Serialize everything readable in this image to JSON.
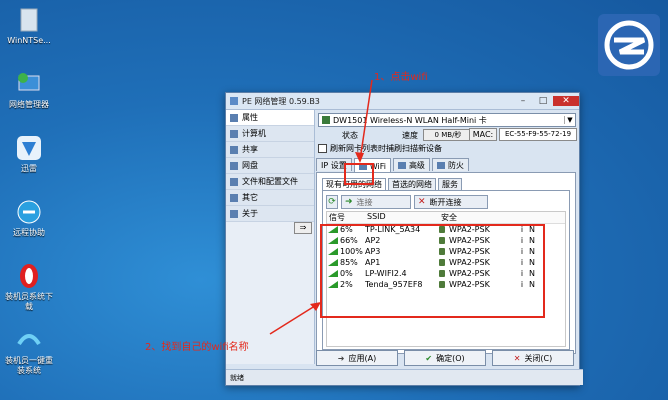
{
  "desktop": {
    "icons": [
      {
        "name": "winntsetup-icon",
        "label": "WinNTSe..."
      },
      {
        "name": "network-manager-icon",
        "label": "网络管理器"
      },
      {
        "name": "thunder-icon",
        "label": "迅雷"
      },
      {
        "name": "remote-assist-icon",
        "label": "远程协助"
      },
      {
        "name": "installer-download-icon",
        "label": "装机员系统下载"
      },
      {
        "name": "installer-onekey-icon",
        "label": "装机员一键重装系统"
      }
    ]
  },
  "window": {
    "title": "PE 网络管理 0.59.B3",
    "sidebar": [
      "属性",
      "计算机",
      "共享",
      "网盘",
      "文件和配置文件",
      "其它",
      "关于"
    ],
    "sidebar_arrow": "⇒",
    "adapter": "DW1501 Wireless-N WLAN Half-Mini 卡",
    "status_label": "状态",
    "status_value": "",
    "speed_label": "速度",
    "speed_value": "0 MB/秒",
    "mac_label": "MAC:",
    "mac_value": "EC-55-F9-55-72-19",
    "refresh_checkbox": "刷新网卡列表时捕刷扫描新设备",
    "tabs": [
      "IP 设置",
      "WiFi",
      "高级",
      "防火"
    ],
    "subtabs": [
      "现有可用的网络",
      "首选的网络",
      "服务"
    ],
    "connect_label": "连接",
    "disconnect_label": "断开连接",
    "table": {
      "headers": [
        "信号",
        "SSID",
        "安全",
        "",
        ""
      ],
      "rows": [
        {
          "signal": "6%",
          "ssid": "TP-LINK_5A34",
          "security": "WPA2-PSK",
          "i": "i",
          "n": "N"
        },
        {
          "signal": "66%",
          "ssid": "AP2",
          "security": "WPA2-PSK",
          "i": "i",
          "n": "N"
        },
        {
          "signal": "100%",
          "ssid": "AP3",
          "security": "WPA2-PSK",
          "i": "i",
          "n": "N"
        },
        {
          "signal": "85%",
          "ssid": "AP1",
          "security": "WPA2-PSK",
          "i": "i",
          "n": "N"
        },
        {
          "signal": "0%",
          "ssid": "LP-WIFI2.4",
          "security": "WPA2-PSK",
          "i": "i",
          "n": "N"
        },
        {
          "signal": "2%",
          "ssid": "Tenda_957EF8",
          "security": "WPA2-PSK",
          "i": "i",
          "n": "N"
        }
      ]
    },
    "apply_label": "应用(A)",
    "ok_label": "确定(O)",
    "close_label": "关闭(C)",
    "status_bar": "就绪"
  },
  "annotations": {
    "step1": "1、点击wifi",
    "step2": "2、找到自己的wifi名称"
  },
  "colors": {
    "accent": "#e3291c",
    "desktop": "#1f6fb8"
  }
}
